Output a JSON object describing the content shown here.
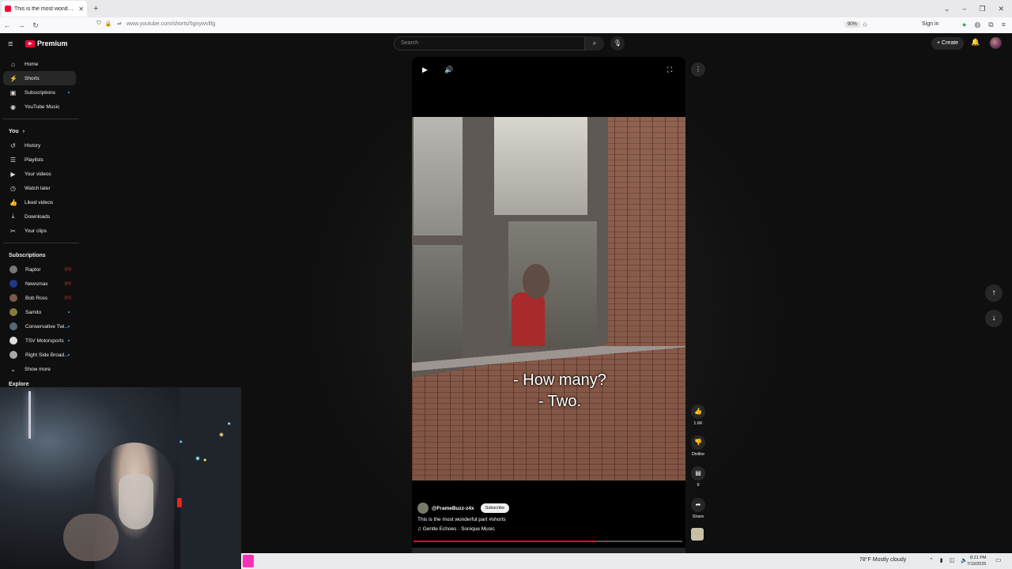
{
  "browser": {
    "tab_title": "This is the most wonderful part",
    "url": "www.youtube.com/shorts/5gnywvlifg",
    "zoom": "90%",
    "sign_in": "Sign in"
  },
  "header": {
    "logo_text": "Premium",
    "search_placeholder": "Search",
    "create_label": "Create"
  },
  "sidebar": {
    "main": [
      {
        "label": "Home",
        "icon": "home-icon"
      },
      {
        "label": "Shorts",
        "icon": "shorts-icon"
      },
      {
        "label": "Subscriptions",
        "icon": "subscriptions-icon"
      },
      {
        "label": "YouTube Music",
        "icon": "music-icon"
      }
    ],
    "you_label": "You",
    "you": [
      {
        "label": "History",
        "icon": "history-icon"
      },
      {
        "label": "Playlists",
        "icon": "playlists-icon"
      },
      {
        "label": "Your videos",
        "icon": "your-videos-icon"
      },
      {
        "label": "Watch later",
        "icon": "watch-later-icon"
      },
      {
        "label": "Liked videos",
        "icon": "liked-icon"
      },
      {
        "label": "Downloads",
        "icon": "download-icon"
      },
      {
        "label": "Your clips",
        "icon": "clips-icon"
      }
    ],
    "subscriptions_label": "Subscriptions",
    "subscriptions": [
      {
        "label": "Raptor",
        "color": "#777777"
      },
      {
        "label": "Newsmax",
        "color": "#1a3a8a"
      },
      {
        "label": "Bob Ross",
        "color": "#7a5a4a"
      },
      {
        "label": "Samito",
        "color": "#8a7a3a"
      },
      {
        "label": "Conservative Twi...",
        "color": "#556677"
      },
      {
        "label": "TSV Motorsports",
        "color": "#dddddd"
      },
      {
        "label": "Right Side Broad...",
        "color": "#aaaaaa"
      }
    ],
    "show_more": "Show more",
    "explore_label": "Explore"
  },
  "short": {
    "caption_line1": "- How many?",
    "caption_line2": "- Two.",
    "channel": "@FrameBuzz-z4x",
    "subscribe": "Subscribe",
    "title": "This is the most wonderful part #shorts",
    "music": "Gentle Echoes · Sonique Music",
    "progress": 0.68
  },
  "actions": {
    "likes": "1.6K",
    "dislike": "Dislike",
    "comments": "9",
    "share": "Share"
  },
  "taskbar": {
    "weather": "78°F  Mostly cloudy",
    "time": "8:21 PM",
    "date": "7/19/2025"
  }
}
